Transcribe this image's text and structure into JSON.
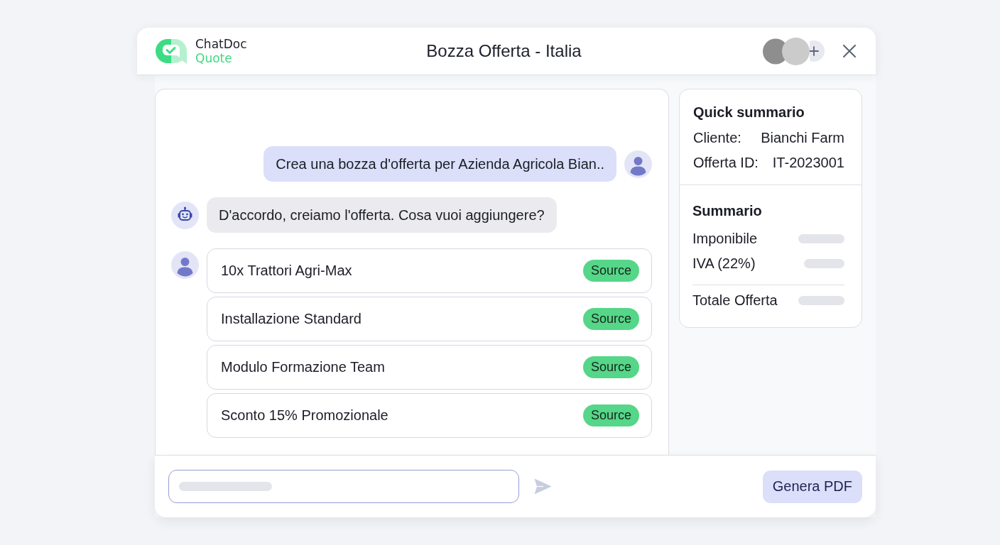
{
  "header": {
    "logo": {
      "name": "ChatDoc",
      "product": "Quote"
    },
    "title": "Bozza Offerta - Italia",
    "collaborators": [
      {
        "color": "#8e8e8e"
      },
      {
        "color": "#cbcbcb"
      }
    ]
  },
  "chat": {
    "messages": [
      {
        "kind": "request",
        "text": "Crea una bozza d'offerta per Azienda Agricola Bian.."
      },
      {
        "kind": "reply",
        "text": "D'accordo, creiamo l'offerta. Cosa vuoi aggiungere?"
      },
      {
        "kind": "selection",
        "items": [
          {
            "label": "10x Trattori Agri-Max",
            "badge": "Source"
          },
          {
            "label": "Installazione Standard",
            "badge": "Source"
          },
          {
            "label": "Modulo Formazione Team",
            "badge": "Source"
          },
          {
            "label": "Sconto 15% Promozionale",
            "badge": "Source"
          }
        ]
      }
    ]
  },
  "quick_summary": {
    "title": "Quick summario",
    "fields": [
      {
        "label": "Cliente:",
        "value": "Bianchi Farm"
      },
      {
        "label": "Offerta ID:",
        "value": "IT-2023001"
      }
    ]
  },
  "summary": {
    "title": "Summario",
    "rows": [
      {
        "label": "Imponibile",
        "kind": "line"
      },
      {
        "label": "IVA (22%)",
        "kind": "line"
      },
      {
        "label": "Totale Offerta",
        "kind": "total"
      }
    ]
  },
  "footer": {
    "actions": [
      "Genera PDF"
    ]
  }
}
